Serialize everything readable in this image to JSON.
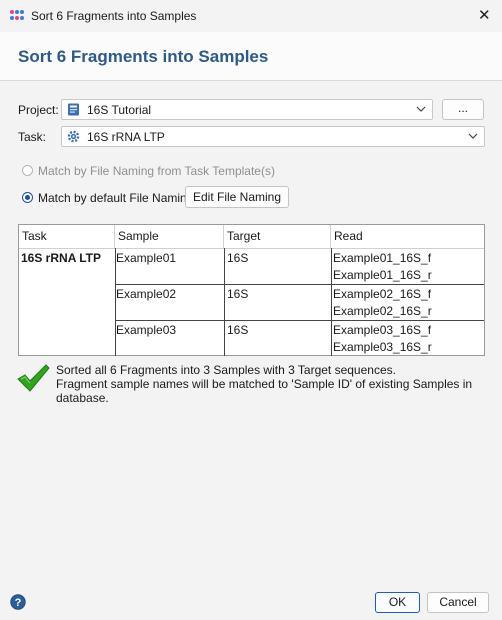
{
  "window": {
    "title": "Sort 6 Fragments into Samples",
    "close_glyph": "✕"
  },
  "heading": "Sort 6 Fragments into Samples",
  "project": {
    "label": "Project:",
    "value": "16S Tutorial",
    "icon": "project-icon",
    "browse_label": "..."
  },
  "task": {
    "label": "Task:",
    "value": "16S rRNA LTP",
    "icon": "gear-icon"
  },
  "options": {
    "template_label": "Match by File Naming from Task Template(s)",
    "default_label": "Match by default File Naming",
    "edit_label": "Edit File Naming",
    "selected": "default"
  },
  "table": {
    "headers": [
      "Task",
      "Sample",
      "Target",
      "Read"
    ],
    "task_name": "16S rRNA LTP",
    "samples": [
      {
        "sample": "Example01",
        "target": "16S",
        "reads": [
          "Example01_16S_f",
          "Example01_16S_r"
        ]
      },
      {
        "sample": "Example02",
        "target": "16S",
        "reads": [
          "Example02_16S_f",
          "Example02_16S_r"
        ]
      },
      {
        "sample": "Example03",
        "target": "16S",
        "reads": [
          "Example03_16S_f",
          "Example03_16S_r"
        ]
      }
    ]
  },
  "status": {
    "line1": "Sorted all 6 Fragments into 3 Samples with 3 Target sequences.",
    "line2": "Fragment sample names will be matched to 'Sample ID' of existing Samples in database.",
    "icon": "checkmark-icon"
  },
  "buttons": {
    "ok": "OK",
    "cancel": "Cancel"
  },
  "colors": {
    "heading": "#2e5a88",
    "accent": "#1b4f9e",
    "check": "#2fa41c"
  }
}
